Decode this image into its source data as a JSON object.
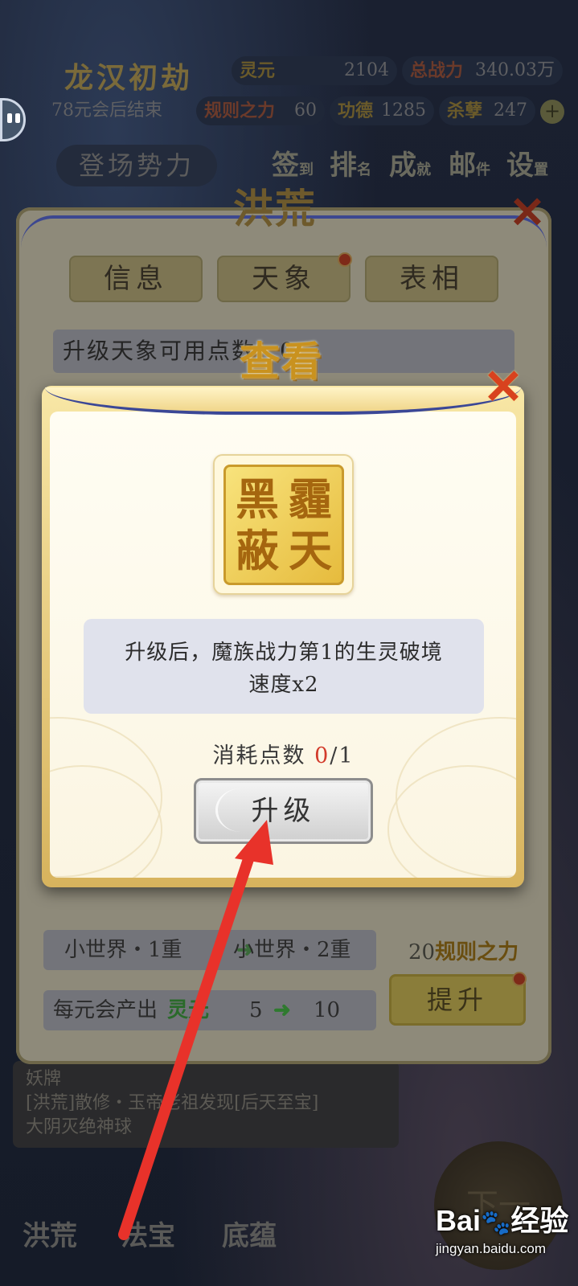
{
  "background": {
    "title": "龙汉初劫",
    "timer": "78元会后结束",
    "stats": [
      {
        "label": "灵元",
        "value": "2104"
      },
      {
        "label": "总战力",
        "value": "340.03万"
      },
      {
        "label": "规则之力",
        "value": "60"
      },
      {
        "label": "功德",
        "value": "1285"
      },
      {
        "label": "杀孽",
        "value": "247"
      }
    ],
    "faction_button": "登场势力",
    "top_nav": [
      {
        "main": "签",
        "sub": "到"
      },
      {
        "main": "排",
        "sub": "名"
      },
      {
        "main": "成",
        "sub": "就"
      },
      {
        "main": "邮",
        "sub": "件"
      },
      {
        "main": "设",
        "sub": "置"
      }
    ],
    "log_lines": [
      "妖牌",
      "[洪荒]散修・玉帝老祖发现[后天至宝]",
      "大阴灭绝神球"
    ],
    "bottom_nav": [
      "洪荒",
      "法宝",
      "底蕴"
    ],
    "next_button": "下一"
  },
  "outer_panel": {
    "title": "洪荒",
    "tabs": [
      "信息",
      "天象",
      "表相"
    ],
    "hint": "升级天象可用点数：0",
    "world_from": "小世界・1重",
    "world_to": "小世界・2重",
    "output_label": "每元会产出",
    "output_resource": "灵元",
    "output_from": "5",
    "output_to": "10",
    "cost_amount": "20",
    "cost_resource": "规则之力",
    "upgrade_button": "提升"
  },
  "modal": {
    "title": "查看",
    "seal_chars": [
      "黑",
      "霾",
      "蔽",
      "天"
    ],
    "description_line1": "升级后，魔族战力第1的生灵破境",
    "description_line2": "速度x2",
    "cost_label": "消耗点数",
    "cost_current": "0",
    "cost_total": "/1",
    "button_label": "升级"
  },
  "watermark": {
    "logo_a": "Bai",
    "logo_b": "经验",
    "url": "jingyan.baidu.com"
  },
  "colors": {
    "accent_gold": "#c9921f",
    "close_red": "#d8421e",
    "arrow_red": "#e8322a",
    "panel_blue": "#3b4796",
    "cost_red": "#d23a2a"
  }
}
